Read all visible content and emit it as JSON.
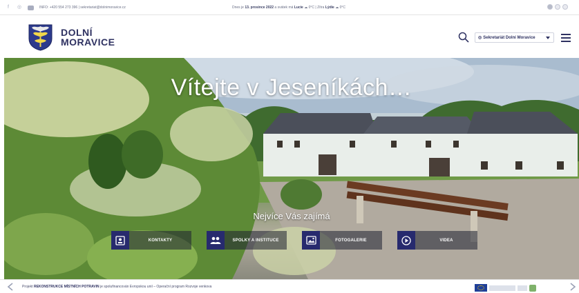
{
  "topbar": {
    "info": "INFO: +420 554 273 396 | sekretariat@dolnimoravice.cz",
    "date_prefix": "Dnes je ",
    "date": "13. prosince 2022",
    "date_suffix": " a svátek má ",
    "nameday": "Lucie",
    "today_temp": "0°C",
    "tomorrow_prefix": "| Zítra ",
    "tomorrow_name": "Lýdie",
    "tomorrow_temp": "0°C",
    "social_icons": [
      "facebook-icon",
      "instagram-icon",
      "youtube-icon"
    ]
  },
  "header": {
    "logo_line1": "DOLNÍ",
    "logo_line2": "MORAVICE",
    "sekretariat_label": "Sekretariát Dolní Moravice"
  },
  "hero": {
    "title": "Vítejte v Jeseníkách…",
    "subtitle": "Nejvíce Vás zajímá",
    "quick_links": [
      {
        "label": "KONTAKTY",
        "icon": "contact-card-icon"
      },
      {
        "label": "SPOLKY A INSTITUCE",
        "icon": "people-group-icon"
      },
      {
        "label": "FOTOGALERIE",
        "icon": "photo-icon"
      },
      {
        "label": "VIDEA",
        "icon": "play-icon"
      }
    ]
  },
  "bottombar": {
    "text_prefix": "Projekt ",
    "project": "REKONSTRUKCE MÍSTNÍCH POTRAVIN",
    "text_suffix": " je spolufinancován Evropskou unií – Operační program Rozvoje venkova"
  },
  "colors": {
    "brand_navy": "#2e3161",
    "icon_block": "#272a6e"
  }
}
